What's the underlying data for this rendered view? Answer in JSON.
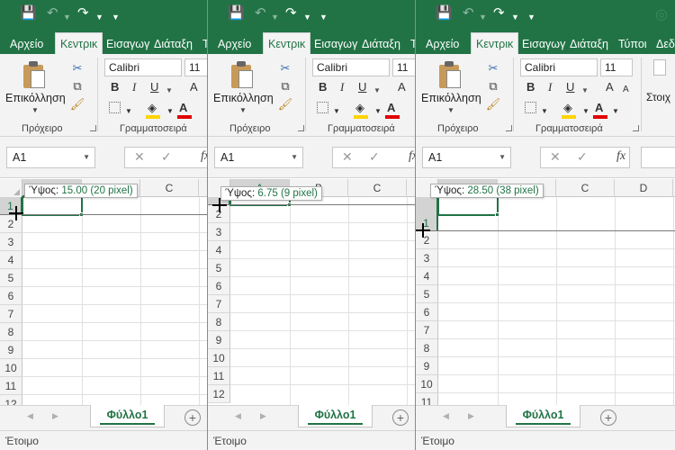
{
  "colors": {
    "brand": "#217346",
    "accent_text": "#217346",
    "highlight": "#ffd400",
    "font_color": "#e00000"
  },
  "qat_icons": [
    "save-icon",
    "undo-icon",
    "redo-icon",
    "customize-qat-icon"
  ],
  "tabs": {
    "file": "Αρχείο",
    "home": "Κεντρικ",
    "insert": "Εισαγωγ",
    "layout": "Διάταξη",
    "layout_cut": "Τ",
    "layout_full": "Διάταξη",
    "formulas": "Τύποι",
    "data": "Δεδο"
  },
  "ribbon": {
    "paste_label": "Επικόλληση",
    "clipboard_group": "Πρόχειρο",
    "font_group": "Γραμματοσειρά",
    "font_name": "Calibri",
    "font_size": "11",
    "bold": "B",
    "italic": "I",
    "underline": "U",
    "grow_font": "A",
    "styles_label": "Στοιχ"
  },
  "formula_bar": {
    "name_box": "A1",
    "fx": "fx"
  },
  "grid": {
    "columns_p0": [
      "B",
      "C"
    ],
    "columns_p1": [
      "A",
      "B",
      "C"
    ],
    "columns_p2": [
      "B",
      "C",
      "D"
    ],
    "row_numbers": [
      "1",
      "2",
      "3",
      "4",
      "5",
      "6",
      "7",
      "8",
      "9",
      "10",
      "11",
      "12"
    ]
  },
  "tooltips": [
    {
      "label": "Ύψος: ",
      "value": "15.00 (20 pixel)"
    },
    {
      "label": "Ύψος: ",
      "value": "6.75 (9 pixel)"
    },
    {
      "label": "Ύψος: ",
      "value": "28.50 (38 pixel)"
    }
  ],
  "sheet_tab": "Φύλλο1",
  "add_sheet": "+",
  "status": "Έτοιμο"
}
